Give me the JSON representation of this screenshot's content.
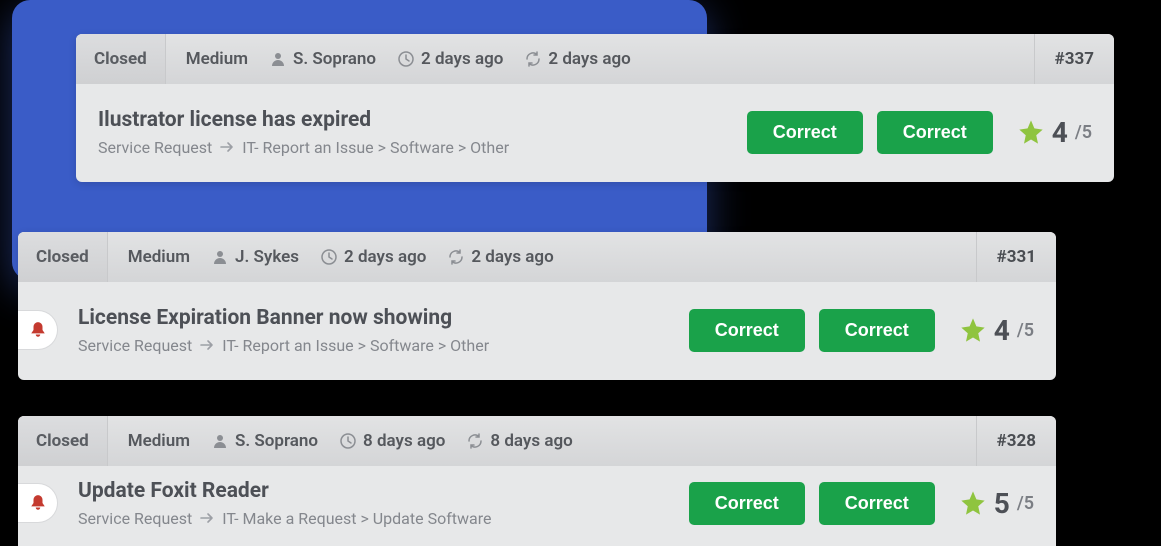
{
  "tickets": [
    {
      "status": "Closed",
      "priority": "Medium",
      "assignee": "S. Soprano",
      "created": "2 days ago",
      "updated": "2 days ago",
      "id": "#337",
      "title": "Ilustrator license has expired",
      "type": "Service Request",
      "category": "IT- Report an Issue > Software > Other",
      "btn1": "Correct",
      "btn2": "Correct",
      "rating_value": "4",
      "rating_max": "/5",
      "has_bell": false
    },
    {
      "status": "Closed",
      "priority": "Medium",
      "assignee": "J. Sykes",
      "created": "2 days ago",
      "updated": "2 days ago",
      "id": "#331",
      "title": "License Expiration Banner now showing",
      "type": "Service Request",
      "category": "IT- Report an Issue > Software > Other",
      "btn1": "Correct",
      "btn2": "Correct",
      "rating_value": "4",
      "rating_max": "/5",
      "has_bell": true
    },
    {
      "status": "Closed",
      "priority": "Medium",
      "assignee": "S. Soprano",
      "created": "8 days ago",
      "updated": "8 days ago",
      "id": "#328",
      "title": "Update Foxit Reader",
      "type": "Service Request",
      "category": "IT- Make a Request > Update Software",
      "btn1": "Correct",
      "btn2": "Correct",
      "rating_value": "5",
      "rating_max": "/5",
      "has_bell": true
    }
  ]
}
